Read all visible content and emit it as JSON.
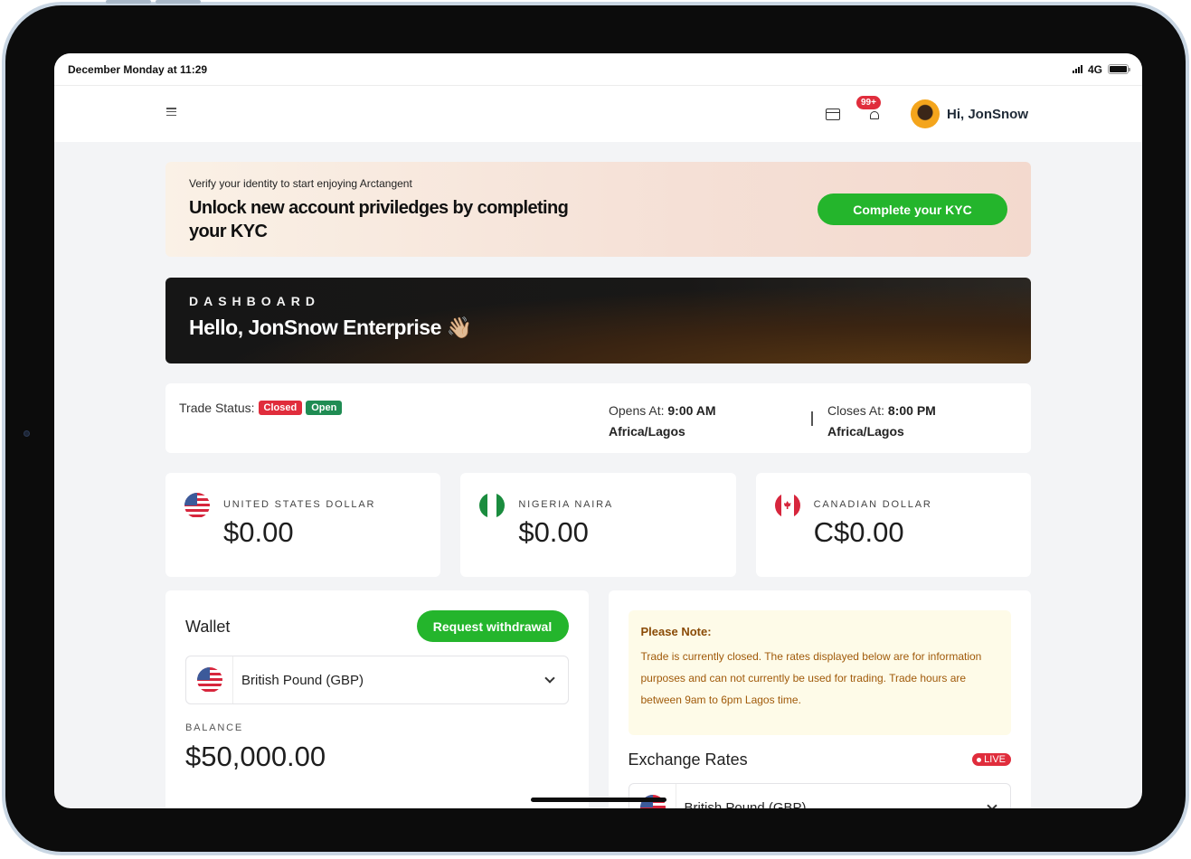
{
  "status_bar": {
    "time": "December Monday at 11:29",
    "network": "4G"
  },
  "nav": {
    "notification_count": "99+",
    "greeting": "Hi, JonSnow"
  },
  "kyc_banner": {
    "subtitle": "Verify your identity to start enjoying Arctangent",
    "title": "Unlock new account priviledges by completing your KYC",
    "button": "Complete your KYC"
  },
  "dashboard": {
    "label": "DASHBOARD",
    "hello": "Hello, JonSnow Enterprise 👋🏼"
  },
  "trade_status": {
    "label": "Trade Status:",
    "closed_badge": "Closed",
    "open_badge": "Open",
    "opens_label": "Opens At:",
    "opens_time": "9:00 AM",
    "opens_zone": "Africa/Lagos",
    "closes_label": "Closes At:",
    "closes_time": "8:00 PM",
    "closes_zone": "Africa/Lagos"
  },
  "balances": [
    {
      "name": "UNITED STATES DOLLAR",
      "amount": "$0.00",
      "flag": "us-flag"
    },
    {
      "name": "NIGERIA NAIRA",
      "amount": "$0.00",
      "flag": "ng-flag"
    },
    {
      "name": "CANADIAN DOLLAR",
      "amount": "C$0.00",
      "flag": "ca-flag"
    }
  ],
  "wallet": {
    "title": "Wallet",
    "withdraw_button": "Request withdrawal",
    "selected_currency": "British Pound (GBP)",
    "balance_label": "BALANCE",
    "balance_amount": "$50,000.00"
  },
  "note": {
    "title": "Please Note:",
    "text": "Trade is currently closed. The rates displayed below are for information purposes and can not currently be used for trading. Trade hours are between 9am to 6pm Lagos time."
  },
  "exchange": {
    "title": "Exchange Rates",
    "live_badge": "LIVE",
    "selected_currency": "British Pound (GBP)"
  },
  "colors": {
    "accent_green": "#24b52c",
    "badge_red": "#e02d3c",
    "badge_green": "#1f8c53",
    "note_bg": "#fefbe8"
  }
}
